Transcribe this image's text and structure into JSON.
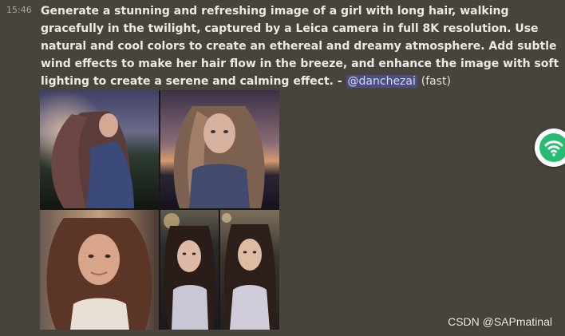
{
  "message": {
    "timestamp": "15:46",
    "prompt": "Generate a stunning and refreshing image of a girl with long hair, walking gracefully in the twilight, captured by a Leica camera in full 8K resolution. Use natural and cool colors to create an ethereal and dreamy atmosphere. Add subtle wind effects to make her hair flow in the breeze, and enhance the image with soft lighting to create a serene and calming effect. -",
    "mention": "@danchezai",
    "mode": "(fast)"
  },
  "image_grid": {
    "tiles": [
      {
        "name": "generated-image-1",
        "icon": "portrait-image"
      },
      {
        "name": "generated-image-2",
        "icon": "portrait-image"
      },
      {
        "name": "generated-image-3",
        "icon": "portrait-image"
      },
      {
        "name": "generated-image-4",
        "icon": "portrait-image"
      },
      {
        "name": "generated-image-5",
        "icon": "portrait-image"
      }
    ]
  },
  "floating_widget": {
    "icon": "wifi-icon",
    "accent_color": "#27bb72"
  },
  "watermark": {
    "text": "CSDN @SAPmatinal"
  },
  "colors": {
    "background": "#48443d",
    "text": "#eceae4",
    "mention_bg": "#4b4f7f",
    "mention_text": "#d1d7ff"
  }
}
